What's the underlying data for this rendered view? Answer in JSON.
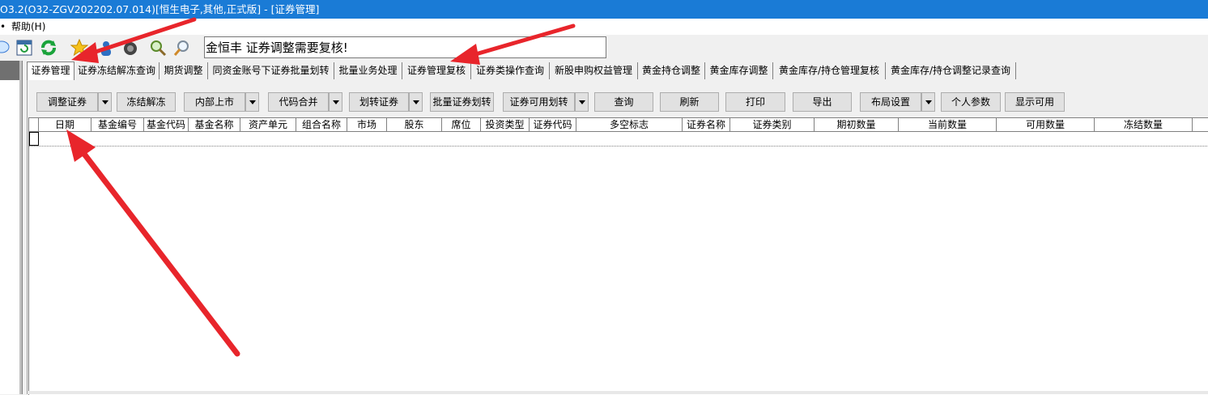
{
  "window": {
    "title": "O3.2(O32-ZGV202202.07.014)[恒生电子,其他,正式版] - [证券管理]"
  },
  "menubar": {
    "help_label": "帮助(H)"
  },
  "toolbar": {
    "notice_text": "金恒丰  证券调整需要复核!"
  },
  "tabs": [
    {
      "label": "证券管理",
      "active": true
    },
    {
      "label": "证券冻结解冻查询"
    },
    {
      "label": "期货调整"
    },
    {
      "label": "同资金账号下证券批量划转"
    },
    {
      "label": "批量业务处理"
    },
    {
      "label": "证券管理复核"
    },
    {
      "label": "证券类操作查询"
    },
    {
      "label": "新股申购权益管理"
    },
    {
      "label": "黄金持仓调整"
    },
    {
      "label": "黄金库存调整"
    },
    {
      "label": "黄金库存/持仓管理复核"
    },
    {
      "label": "黄金库存/持仓调整记录查询"
    }
  ],
  "buttons": {
    "adjust": "调整证券",
    "freeze": "冻结解冻",
    "internal_listing": "内部上市",
    "code_merge": "代码合并",
    "transfer": "划转证券",
    "batch_transfer": "批量证券划转",
    "available_transfer": "证券可用划转",
    "query": "查询",
    "refresh": "刷新",
    "print": "打印",
    "export": "导出",
    "layout": "布局设置",
    "personal": "个人参数",
    "show_available": "显示可用"
  },
  "grid": {
    "columns": [
      "日期",
      "基金编号",
      "基金代码",
      "基金名称",
      "资产单元",
      "组合名称",
      "市场",
      "股东",
      "席位",
      "投资类型",
      "证券代码",
      "多空标志",
      "证券名称",
      "证券类别",
      "期初数量",
      "当前数量",
      "可用数量",
      "冻结数量"
    ]
  },
  "colors": {
    "titlebar": "#1a7bd6",
    "annotation_arrow": "#e8252b"
  }
}
